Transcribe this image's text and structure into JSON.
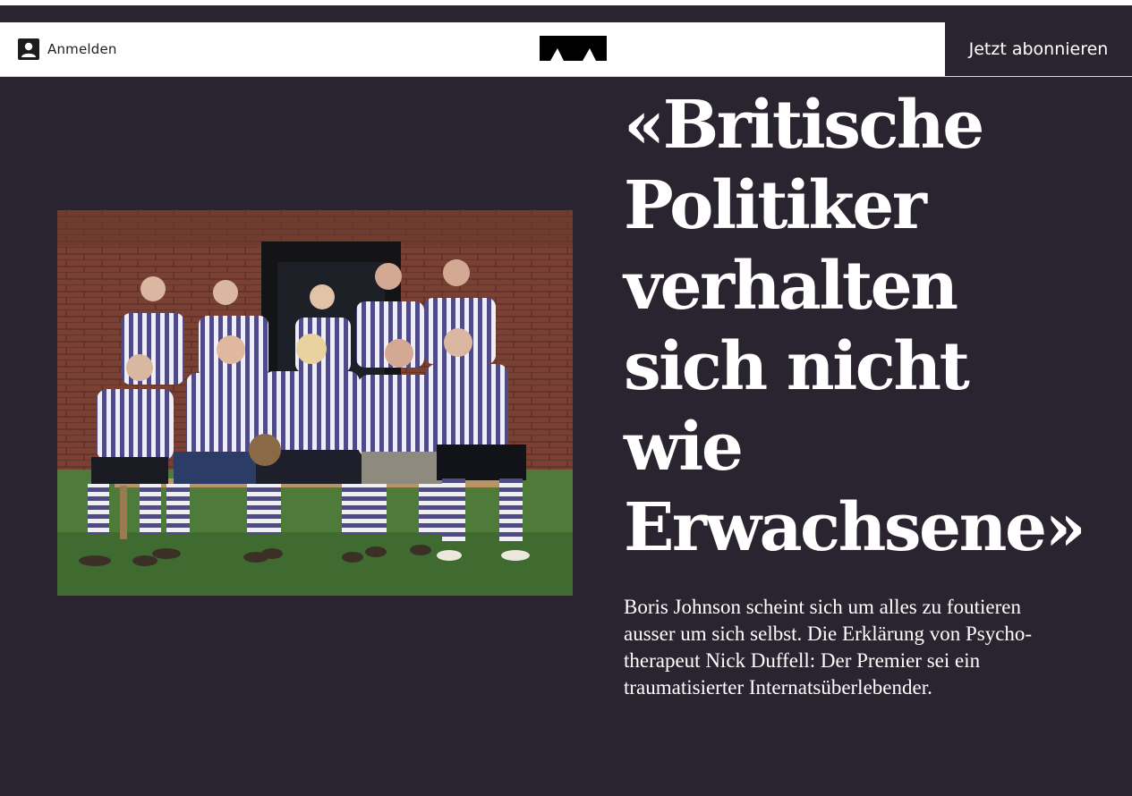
{
  "header": {
    "login_label": "Anmelden",
    "login_icon": "user-icon",
    "logo_icon": "publication-logo",
    "subscribe_label": "Jetzt abonnieren"
  },
  "article": {
    "headline_lines": [
      "«Britische",
      "Politiker",
      "verhalten",
      "sich nicht",
      "wie",
      "Erwachsene»"
    ],
    "lead_lines": [
      "Boris Johnson scheint sich um alles zu foutieren",
      "ausser um sich selbst. Die Erklärung von Psycho-",
      "therapeut Nick Duffell: Der Premier sei ein",
      "traumatisierter Internatsüberlebender."
    ]
  },
  "colors": {
    "background": "#29242f",
    "header_background": "#ffffff",
    "subscribe_background": "#29242f",
    "text_light": "#ffffff",
    "text_dark": "#1e1e1e"
  }
}
